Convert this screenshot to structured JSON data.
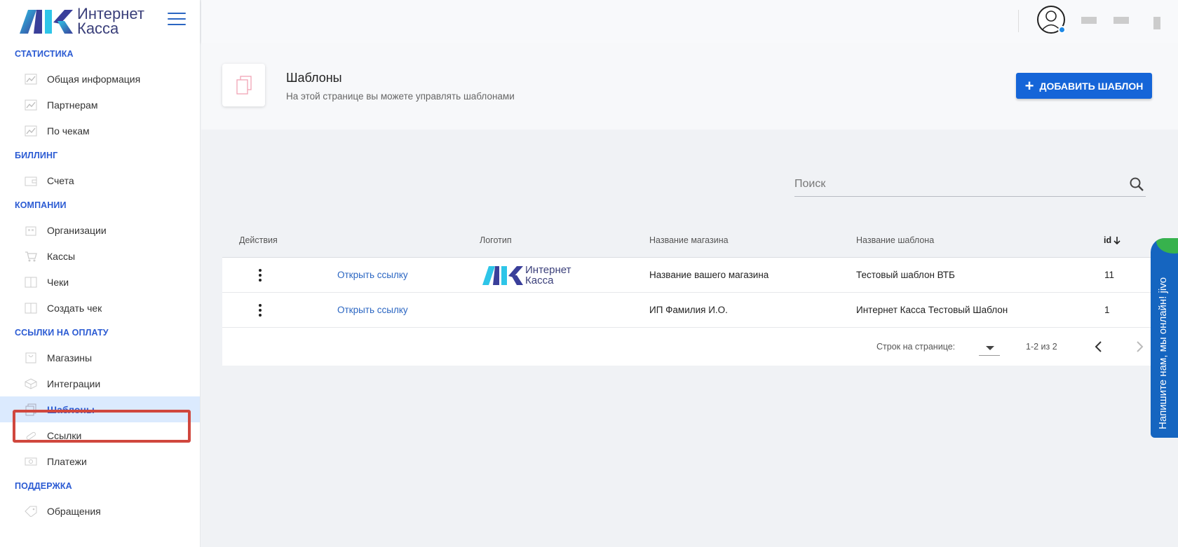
{
  "brand": {
    "line1": "Интернет",
    "line2": "Касса",
    "colors": {
      "accent": "#2b5bd3",
      "button": "#1565d8",
      "highlight": "#d0473e"
    }
  },
  "sidebar": {
    "sections": [
      {
        "title": "СТАТИСТИКА",
        "items": [
          "Общая информация",
          "Партнерам",
          "По чекам"
        ]
      },
      {
        "title": "БИЛЛИНГ",
        "items": [
          "Счета"
        ]
      },
      {
        "title": "КОМПАНИИ",
        "items": [
          "Организации",
          "Кассы",
          "Чеки",
          "Создать чек"
        ]
      },
      {
        "title": "ССЫЛКИ НА ОПЛАТУ",
        "items": [
          "Магазины",
          "Интеграции",
          "Шаблоны",
          "Ссылки",
          "Платежи"
        ]
      },
      {
        "title": "ПОДДЕРЖКА",
        "items": [
          "Обращения"
        ]
      }
    ],
    "active_item": "Шаблоны"
  },
  "header": {
    "title": "Шаблоны",
    "subtitle": "На этой странице вы можете управлять шаблонами",
    "add_button": "ДОБАВИТЬ ШАБЛОН"
  },
  "search": {
    "placeholder": "Поиск"
  },
  "table": {
    "columns": {
      "actions": "Действия",
      "logo": "Логотип",
      "shop": "Название магазина",
      "template": "Название шаблона",
      "id": "id"
    },
    "rows": [
      {
        "link": "Открыть ссылку",
        "has_logo": true,
        "shop": "Название вашего магазина",
        "template": "Тестовый шаблон ВТБ",
        "id": "11"
      },
      {
        "link": "Открыть ссылку",
        "has_logo": false,
        "shop": "ИП Фамилия И.О.",
        "template": "Интернет Касса Тестовый Шаблон",
        "id": "1"
      }
    ],
    "footer": {
      "rows_per_page_label": "Строк на странице:",
      "range": "1-2 из 2"
    }
  },
  "chat": {
    "label": "Напишите нам, мы онлайн!",
    "brand": "jivo"
  }
}
